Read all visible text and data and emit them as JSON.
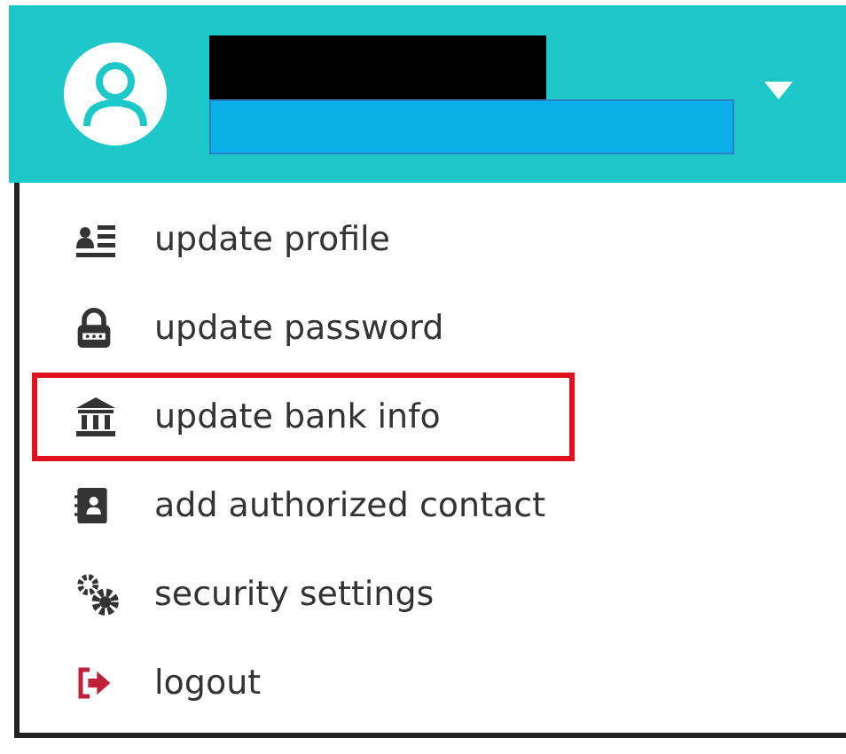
{
  "header": {
    "expanded": true
  },
  "menu": [
    {
      "label": "update profile",
      "kind": "profile",
      "highlighted": false
    },
    {
      "label": "update password",
      "kind": "password",
      "highlighted": false
    },
    {
      "label": "update bank info",
      "kind": "bank",
      "highlighted": true
    },
    {
      "label": "add authorized contact",
      "kind": "contact",
      "highlighted": false
    },
    {
      "label": "security settings",
      "kind": "settings",
      "highlighted": false
    },
    {
      "label": "logout",
      "kind": "logout",
      "highlighted": false
    }
  ]
}
